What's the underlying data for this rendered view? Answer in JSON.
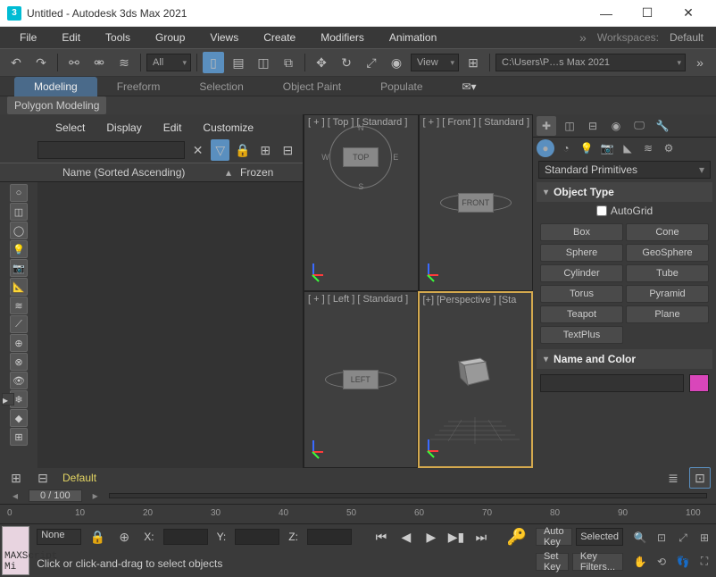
{
  "title": "Untitled - Autodesk 3ds Max 2021",
  "app_icon": "3",
  "menu": [
    "File",
    "Edit",
    "Tools",
    "Group",
    "Views",
    "Create",
    "Modifiers",
    "Animation"
  ],
  "workspaces_label": "Workspaces:",
  "workspace_value": "Default",
  "maintb": {
    "all_dd": "All",
    "view_dd": "View",
    "path": "C:\\Users\\P…s Max 2021"
  },
  "ribbon": {
    "tabs": [
      "Modeling",
      "Freeform",
      "Selection",
      "Object Paint",
      "Populate"
    ],
    "sub": "Polygon Modeling"
  },
  "scene": {
    "menu": [
      "Select",
      "Display",
      "Edit",
      "Customize"
    ],
    "col1": "Name (Sorted Ascending)",
    "sort": "▴",
    "col2": "Frozen"
  },
  "viewports": {
    "top": "[ + ] [ Top ] [ Standard ]",
    "front": "[ + ] [ Front ] [ Standard ]",
    "left": "[ + ] [ Left ] [ Standard ]",
    "persp": "[+] [Perspective ] [Sta",
    "compass": {
      "n": "N",
      "s": "S",
      "e": "E",
      "w": "W"
    },
    "cube_top": "TOP",
    "cube_front": "FRONT",
    "cube_left": "LEFT"
  },
  "cmd": {
    "dd": "Standard Primitives",
    "roll1": "Object Type",
    "autogrid": "AutoGrid",
    "buttons": [
      "Box",
      "Cone",
      "Sphere",
      "GeoSphere",
      "Cylinder",
      "Tube",
      "Torus",
      "Pyramid",
      "Teapot",
      "Plane",
      "TextPlus",
      ""
    ],
    "roll2": "Name and Color",
    "swatch": "#d946ba"
  },
  "preset": "Default",
  "time": {
    "frame": "0 / 100",
    "ticks": [
      "0",
      "10",
      "20",
      "30",
      "40",
      "50",
      "60",
      "70",
      "80",
      "90",
      "100"
    ]
  },
  "status": {
    "msx": "MAXScript Mi",
    "none": "None",
    "x": "X:",
    "y": "Y:",
    "z": "Z:",
    "hint": "Click or click-and-drag to select objects",
    "autokey": "Auto Key",
    "setkey": "Set Key",
    "selected": "Selected",
    "keyfilters": "Key Filters..."
  }
}
